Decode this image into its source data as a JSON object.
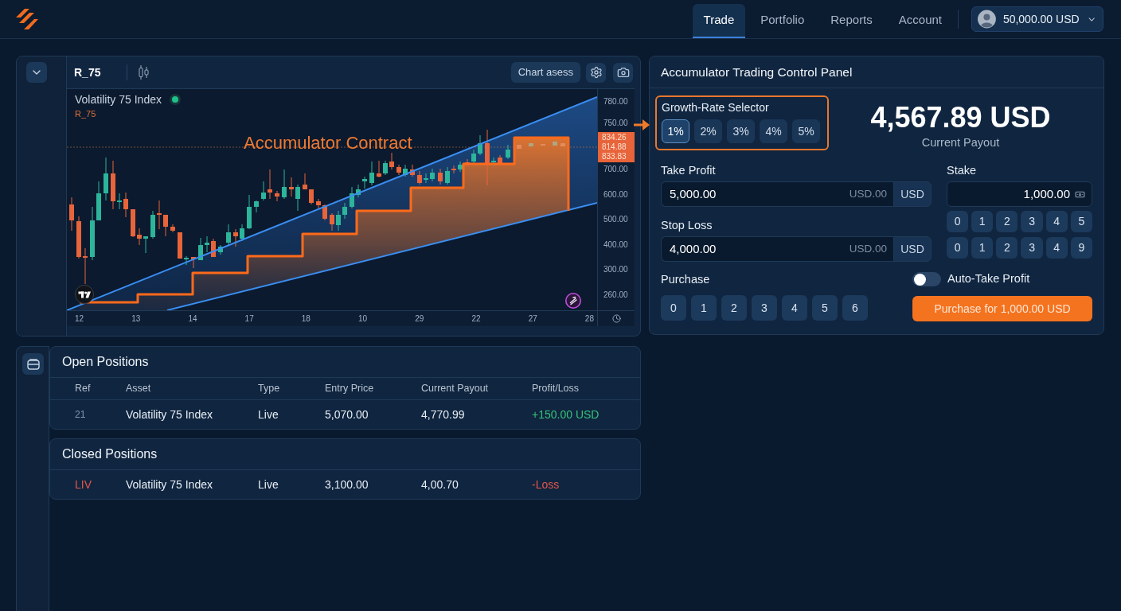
{
  "header": {
    "nav_tabs": [
      {
        "label": "Trade",
        "selected": true
      },
      {
        "label": "Portfolio",
        "selected": false
      },
      {
        "label": "Reports",
        "selected": false
      },
      {
        "label": "Account",
        "selected": false
      }
    ],
    "account_balance": "50,000.00 USD"
  },
  "chart_panel": {
    "symbol": "R_75",
    "toolbar_button": "Chart asess",
    "legend": {
      "name": "Volatility 75 Index",
      "symbol": "R_75",
      "live": true
    },
    "overlay_label": "Accumulator Contract",
    "price_axis": {
      "upper_ticks": [
        "780.00",
        "750.00"
      ],
      "current_prices": [
        "834.26",
        "814.88",
        "833.83"
      ],
      "lower_ticks": [
        "700.00",
        "600.00",
        "500.00",
        "400.00",
        "300.00",
        "260.00"
      ]
    },
    "time_axis": [
      "12",
      "13",
      "14",
      "17",
      "18",
      "10",
      "29",
      "22",
      "27",
      "28"
    ]
  },
  "control_panel": {
    "title": "Accumulator Trading Control Panel",
    "growth_rate": {
      "label": "Growth-Rate Selector",
      "options": [
        {
          "label": "1%",
          "selected": true
        },
        {
          "label": "2%",
          "selected": false
        },
        {
          "label": "3%",
          "selected": false
        },
        {
          "label": "4%",
          "selected": false
        },
        {
          "label": "5%",
          "selected": false
        }
      ]
    },
    "payout": {
      "amount": "4,567.89 USD",
      "label": "Current Payout"
    },
    "take_profit": {
      "label": "Take Profit",
      "value": "5,000.00",
      "suffix": "USD.00",
      "currency": "USD"
    },
    "stop_loss": {
      "label": "Stop Loss",
      "value": "4,000.00",
      "suffix": "USD.00",
      "currency": "USD"
    },
    "stake": {
      "label": "Stake",
      "value": "1,000.00",
      "keypad_rows": [
        {
          "keys": [
            "0",
            "1",
            "2",
            "3",
            "4",
            "5"
          ]
        },
        {
          "keys": [
            "0",
            "1",
            "2",
            "3",
            "4",
            "9"
          ]
        }
      ]
    },
    "purchase": {
      "label": "Purchase",
      "keys": [
        "0",
        "1",
        "2",
        "3",
        "4",
        "5",
        "6"
      ]
    },
    "auto_take_profit": {
      "label": "Auto-Take Profit",
      "on": false
    },
    "purchase_button": "Purchase for 1,000.00 USD"
  },
  "open_positions": {
    "title": "Open Positions",
    "columns": [
      "Ref",
      "Asset",
      "Type",
      "Entry Price",
      "Current Payout",
      "Profit/Loss"
    ],
    "rows": [
      {
        "ref": "21",
        "asset": "Volatility 75 Index",
        "type": "Live",
        "entry_price": "5,070.00",
        "current_payout": "4,770.99",
        "profit_loss": "+150.00 USD",
        "loss": false
      }
    ]
  },
  "closed_positions": {
    "title": "Closed Positions",
    "rows": [
      {
        "ref": "LIV",
        "asset": "Volatility 75 Index",
        "type": "Live",
        "entry_price": "3,100.00",
        "current_payout": "4,00.70",
        "profit_loss": "-Loss",
        "loss": true
      }
    ]
  }
}
